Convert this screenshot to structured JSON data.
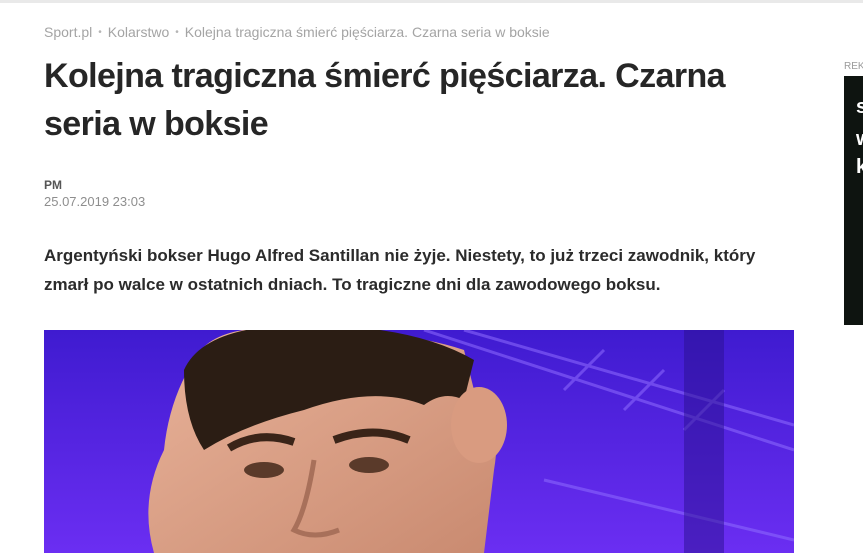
{
  "breadcrumb": {
    "items": [
      "Sport.pl",
      "Kolarstwo",
      "Kolejna tragiczna śmierć pięściarza. Czarna seria w boksie"
    ]
  },
  "article": {
    "title": "Kolejna tragiczna śmierć pięściarza. Czarna seria w boksie",
    "author": "PM",
    "date": "25.07.2019 23:03",
    "lead": "Argentyński bokser Hugo Alfred Santillan nie żyje. Niestety, to już trzeci zawodnik, który zmarł po walce w ostatnich dniach. To tragiczne dni dla zawodowego boksu."
  },
  "ad": {
    "label": "REKLAMA"
  },
  "colors": {
    "title": "#262626",
    "breadcrumb": "#a4a4a4",
    "photo_background": "#5a22e6",
    "ad_background": "#0e1410"
  }
}
